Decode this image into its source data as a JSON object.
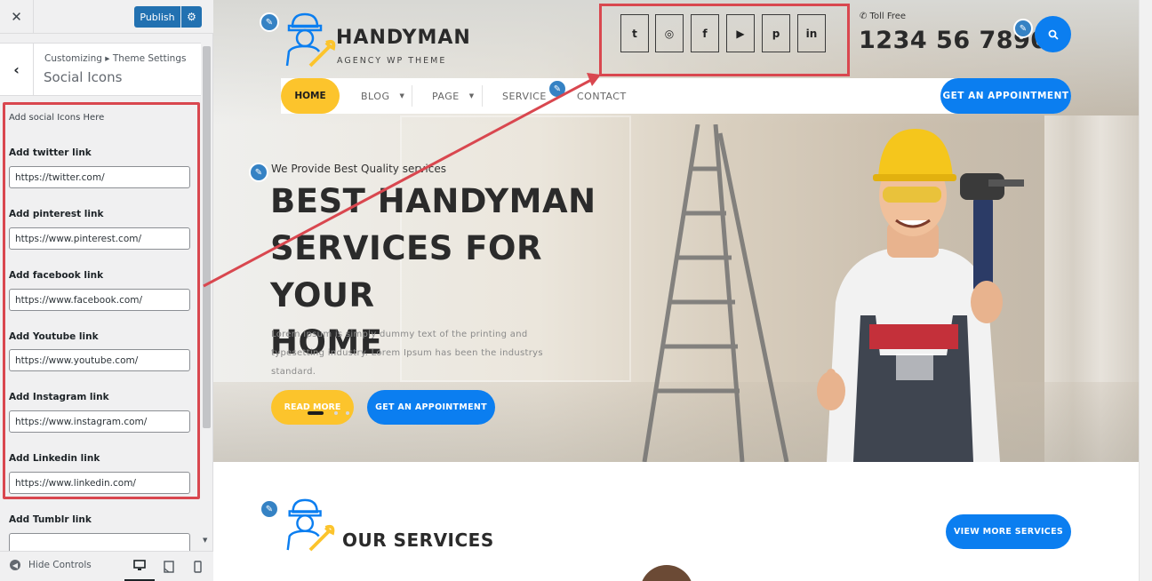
{
  "sidebar": {
    "close_icon": "close-icon",
    "publish_label": "Publish",
    "breadcrumb": "Customizing ▸ Theme Settings",
    "section_title": "Social Icons",
    "description": "Add social Icons Here",
    "fields": [
      {
        "label": "Add twitter link",
        "value": "https://twitter.com/"
      },
      {
        "label": "Add pinterest link",
        "value": "https://www.pinterest.com/"
      },
      {
        "label": "Add facebook link",
        "value": "https://www.facebook.com/"
      },
      {
        "label": "Add Youtube link",
        "value": "https://www.youtube.com/"
      },
      {
        "label": "Add Instagram link",
        "value": "https://www.instagram.com/"
      },
      {
        "label": "Add Linkedin link",
        "value": "https://www.linkedin.com/"
      },
      {
        "label": "Add Tumblr link",
        "value": ""
      }
    ],
    "hide_controls": "Hide Controls"
  },
  "site": {
    "logo_name": "HANDYMAN",
    "logo_tagline": "AGENCY WP THEME",
    "social_icons": [
      {
        "name": "twitter-icon",
        "glyph": "t"
      },
      {
        "name": "instagram-icon",
        "glyph": "◎"
      },
      {
        "name": "facebook-icon",
        "glyph": "f"
      },
      {
        "name": "youtube-icon",
        "glyph": "▶"
      },
      {
        "name": "pinterest-icon",
        "glyph": "p"
      },
      {
        "name": "linkedin-icon",
        "glyph": "in"
      }
    ],
    "toll_free": "✆ Toll Free",
    "phone": "1234 56 7890",
    "nav": {
      "home": "HOME",
      "blog": "BLOG",
      "page": "PAGE",
      "service": "SERVICE",
      "contact": "CONTACT",
      "appointment": "GET AN APPOINTMENT"
    },
    "hero": {
      "subtitle": "We Provide Best Quality services",
      "title_lines": [
        "BEST HANDYMAN",
        "SERVICES FOR YOUR",
        "HOME"
      ],
      "text": "Lorem Ipsum is simply dummy text of the printing and typesetting industry. Lorem Ipsum has been the industrys standard.",
      "read_more": "READ MORE",
      "appointment": "GET AN APPOINTMENT"
    },
    "services": {
      "title": "OUR SERVICES",
      "view_more": "VIEW MORE SERVICES"
    }
  },
  "colors": {
    "wp_blue": "#2271b1",
    "accent_blue": "#0b7ef0",
    "accent_yellow": "#fcc42c",
    "annotation_red": "#d9474f"
  }
}
